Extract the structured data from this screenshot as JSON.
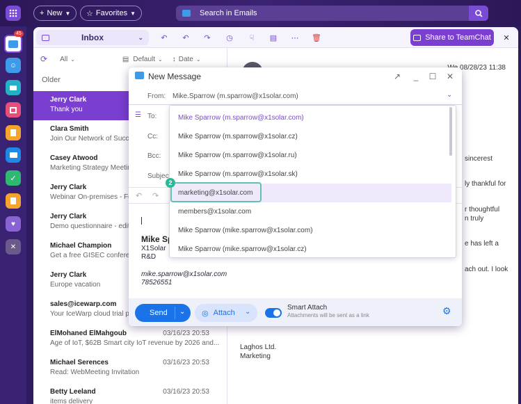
{
  "topbar": {
    "new_label": "New",
    "favorites_label": "Favorites",
    "search_placeholder": "Search in Emails"
  },
  "rail": {
    "mail_badge": "45"
  },
  "toolbar": {
    "folder": "Inbox",
    "share_label": "Share to TeamChat"
  },
  "list": {
    "filter_all": "All",
    "sort_default": "Default",
    "sort_date": "Date",
    "group_label": "Older",
    "items": [
      {
        "name": "Jerry Clark",
        "subject": "Thank you",
        "date": ""
      },
      {
        "name": "Clara Smith",
        "subject": "Join Our Network of Succe",
        "date": ""
      },
      {
        "name": "Casey Atwood",
        "subject": "Marketing Strategy Meetin",
        "date": ""
      },
      {
        "name": "Jerry Clark",
        "subject": "Webinar On-premises - Feb",
        "date": ""
      },
      {
        "name": "Jerry Clark",
        "subject": "Demo questionnaire - edits",
        "date": ""
      },
      {
        "name": "Michael Champion",
        "subject": "Get a free GISEC conferenc",
        "date": ""
      },
      {
        "name": "Jerry Clark",
        "subject": "Europe vacation",
        "date": ""
      },
      {
        "name": "sales@icewarp.com",
        "subject": "Your IceWarp cloud trial pe",
        "date": ""
      },
      {
        "name": "ElMohaned ElMahgoub",
        "subject": "Age of IoT, $62B Smart city IoT revenue by 2026 and...",
        "date": "03/16/23 20:53"
      },
      {
        "name": "Michael Serences",
        "subject": "Read: WebMeeting Invitation",
        "date": "03/16/23 20:53"
      },
      {
        "name": "Betty Leeland",
        "subject": "items delivery",
        "date": "03/16/23 20:53"
      }
    ]
  },
  "reading": {
    "date": "We 08/28/23 11:38",
    "line1": "sincerest",
    "line2": "ly thankful for",
    "line3": "r thoughtful",
    "line4": "n truly",
    "line5": "e has left a",
    "line6": "ach out. I look",
    "company": "Laghos Ltd.",
    "dept": "Marketing"
  },
  "compose": {
    "title": "New Message",
    "from_label": "From:",
    "from_value": "Mike.Sparrow (m.sparrow@x1solar.com)",
    "to_label": "To:",
    "cc_label": "Cc:",
    "bcc_label": "Bcc:",
    "subject_label": "Subject",
    "sig_name": "Mike Sp",
    "sig_company": "X1Solar",
    "sig_dept": "R&D",
    "sig_email": "mike.sparrow@x1solar.com",
    "sig_phone": "78526551",
    "send_label": "Send",
    "attach_label": "Attach",
    "smart_attach_label": "Smart Attach",
    "smart_attach_note": "Attachments will be sent as a link"
  },
  "dropdown": {
    "options": [
      "Mike Sparrow (m.sparrow@x1solar.com)",
      "Mike Sparrow (m.sparrow@x1solar.cz)",
      "Mike Sparrow (m.sparrow@x1solar.ru)",
      "Mike Sparrow (m.sparrow@x1solar.sk)",
      "marketing@x1solar.com",
      "members@x1solar.com",
      "Mike Sparrow (mike.sparrow@x1solar.com)",
      "Mike Sparrow (mike.sparrow@x1solar.cz)"
    ],
    "step_badge": "2"
  },
  "colors": {
    "brand": "#7a3fd0",
    "send": "#1a73e8",
    "highlight": "#5cc4ad"
  }
}
